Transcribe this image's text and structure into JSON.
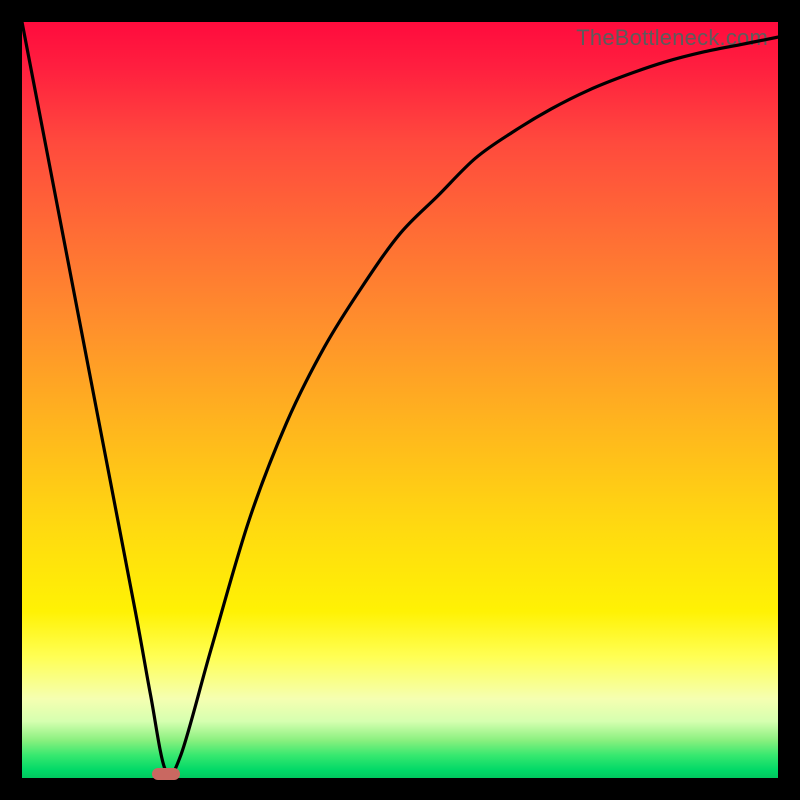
{
  "watermark": "TheBottleneck.com",
  "colors": {
    "frame": "#000000",
    "watermark_text": "#5c5c5c",
    "curve": "#000000",
    "marker": "#c96861"
  },
  "chart_data": {
    "type": "line",
    "title": "",
    "xlabel": "",
    "ylabel": "",
    "xlim": [
      0,
      100
    ],
    "ylim": [
      0,
      100
    ],
    "background_gradient": [
      "red",
      "orange",
      "yellow",
      "green"
    ],
    "series": [
      {
        "name": "bottleneck-curve",
        "x": [
          0,
          5,
          10,
          15,
          17,
          19,
          21,
          25,
          30,
          35,
          40,
          45,
          50,
          55,
          60,
          65,
          70,
          75,
          80,
          85,
          90,
          95,
          100
        ],
        "values": [
          100,
          74,
          48,
          22,
          11,
          1,
          3,
          17,
          34,
          47,
          57,
          65,
          72,
          77,
          82,
          85.5,
          88.5,
          91,
          93,
          94.7,
          96,
          97,
          98
        ]
      }
    ],
    "marker": {
      "x": 19,
      "y": 0.5
    }
  }
}
